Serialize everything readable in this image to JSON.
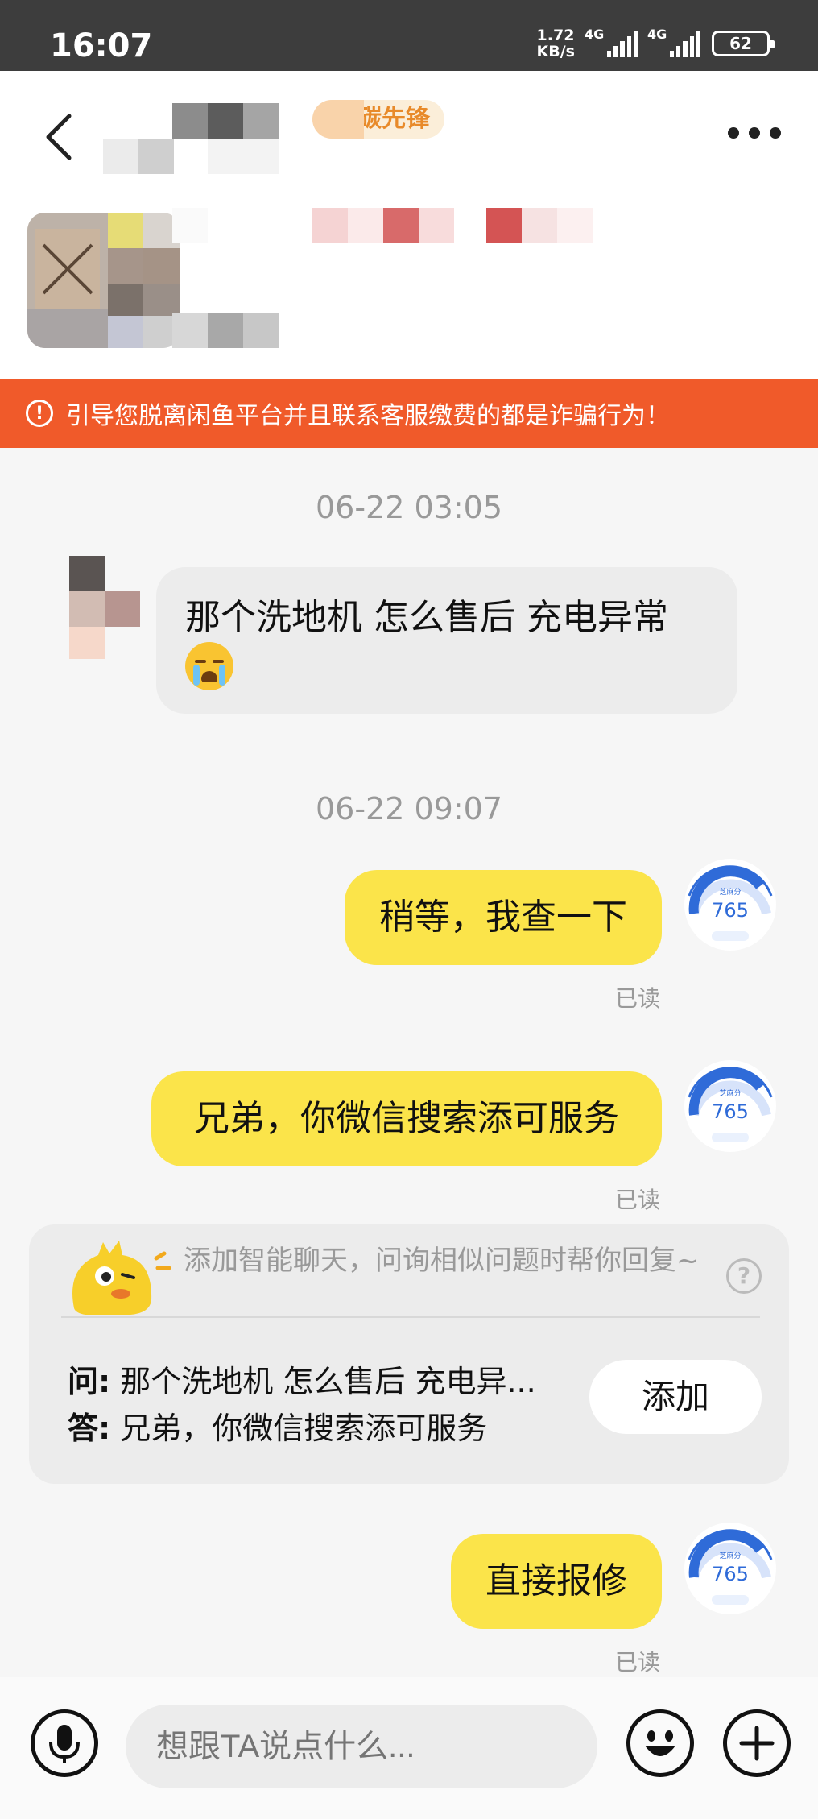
{
  "status_bar": {
    "time": "16:07",
    "net_speed_value": "1.72",
    "net_speed_unit": "KB/s",
    "signal1_label": "4G",
    "signal2_label": "4G",
    "battery": "62"
  },
  "header": {
    "badge_label": "碳先锋",
    "back_icon": "chevron-left-icon",
    "more_icon": "more-dots-icon"
  },
  "warning": {
    "icon": "alert-circle-icon",
    "text": "引导您脱离闲鱼平台并且联系客服缴费的都是诈骗行为！"
  },
  "messages": [
    {
      "timestamp": "06-22 03:05"
    },
    {
      "direction": "in",
      "text": "那个洗地机 怎么售后 充电异常",
      "emoji": "crying-face-emoji"
    },
    {
      "timestamp": "06-22 09:07"
    },
    {
      "direction": "out",
      "text": "稍等，我查一下",
      "status": "已读",
      "avatar_score": "765"
    },
    {
      "direction": "out",
      "text": "兄弟，你微信搜索添可服务",
      "status": "已读",
      "avatar_score": "765"
    },
    {
      "direction": "out",
      "text": "直接报修",
      "status": "已读",
      "avatar_score": "765"
    }
  ],
  "smart_card": {
    "title": "添加智能聊天，问询相似问题时帮你回复~",
    "q_label": "问:",
    "q_text": "那个洗地机 怎么售后 充电异...",
    "a_label": "答:",
    "a_text": "兄弟，你微信搜索添可服务",
    "add_label": "添加",
    "help_icon": "question-circle-icon"
  },
  "input_bar": {
    "placeholder": "想跟TA说点什么...",
    "mic_icon": "microphone-icon",
    "emoji_icon": "smile-icon",
    "plus_icon": "plus-icon"
  },
  "colors": {
    "warning_bg": "#f05a2a",
    "bubble_out": "#fbe44a",
    "bubble_in": "#ececec",
    "score_blue": "#2f6bd8"
  }
}
